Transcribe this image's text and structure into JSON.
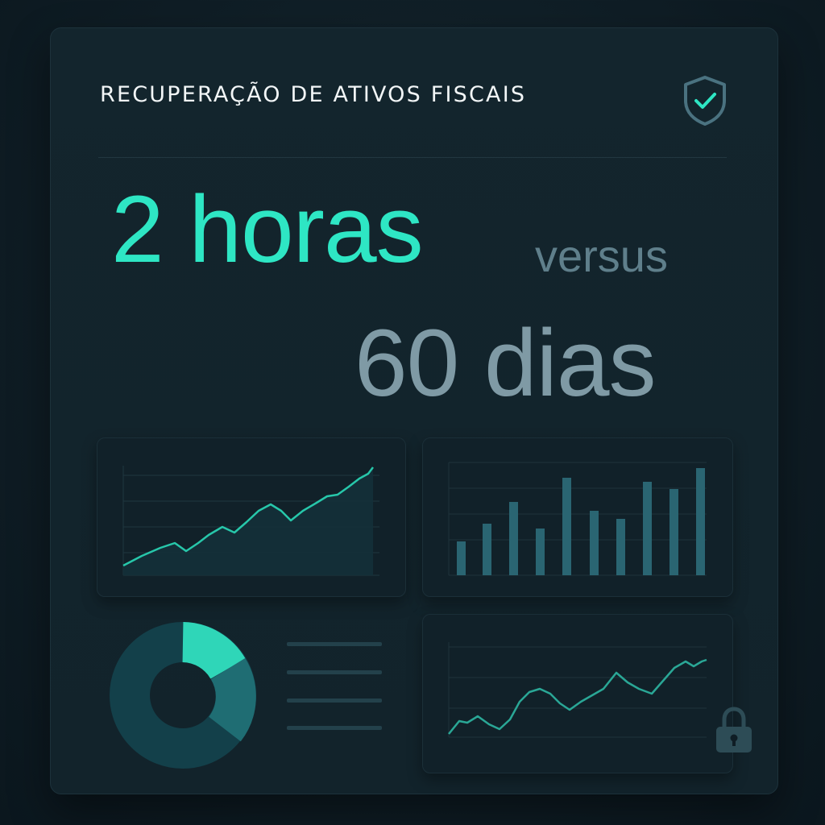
{
  "header": {
    "title": "RECUPERAÇÃO DE ATIVOS FISCAIS",
    "icon": "shield-check-icon"
  },
  "headline": {
    "primary": "2 horas",
    "connector": "versus",
    "secondary": "60 dias"
  },
  "colors": {
    "accent": "#2ee6c4",
    "muted": "#7f9aa5",
    "background": "#12232b"
  },
  "widgets": {
    "line_chart_top": {
      "icon": "line-chart"
    },
    "bar_chart": {
      "icon": "bar-chart"
    },
    "donut_chart": {
      "icon": "donut-chart"
    },
    "line_chart_bottom": {
      "icon": "line-chart"
    },
    "lock": {
      "icon": "lock-icon"
    }
  }
}
